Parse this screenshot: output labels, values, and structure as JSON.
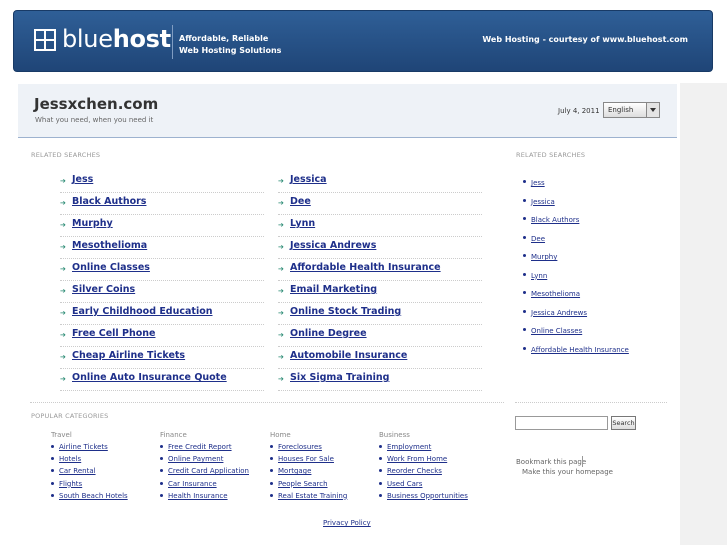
{
  "banner": {
    "logo_light": "blue",
    "logo_bold": "host",
    "tagline_line1": "Affordable, Reliable",
    "tagline_line2": "Web Hosting Solutions",
    "courtesy": "Web Hosting - courtesy of www.bluehost.com"
  },
  "header": {
    "title": "Jessxchen.com",
    "subtitle": "What you need, when you need it",
    "date": "July 4, 2011",
    "language": "English"
  },
  "related": {
    "label": "RELATED SEARCHES",
    "left": [
      "Jess",
      "Black Authors",
      "Murphy",
      "Mesothelioma",
      "Online Classes",
      "Silver Coins",
      "Early Childhood Education",
      "Free Cell Phone",
      "Cheap Airline Tickets",
      "Online Auto Insurance Quote"
    ],
    "right": [
      "Jessica",
      "Dee",
      "Lynn",
      "Jessica Andrews",
      "Affordable Health Insurance",
      "Email Marketing",
      "Online Stock Trading",
      "Online Degree",
      "Automobile Insurance",
      "Six Sigma Training"
    ]
  },
  "sidebar": {
    "label": "RELATED SEARCHES",
    "items": [
      "Jess",
      "Jessica",
      "Black Authors",
      "Dee",
      "Murphy",
      "Lynn",
      "Mesothelioma",
      "Jessica Andrews",
      "Online Classes",
      "Affordable Health Insurance"
    ],
    "search_button": "Search",
    "bookmark": "Bookmark this page",
    "homepage": "Make this your homepage"
  },
  "popular": {
    "label": "POPULAR CATEGORIES",
    "categories": [
      {
        "name": "Travel",
        "items": [
          "Airline Tickets",
          "Hotels",
          "Car Rental",
          "Flights",
          "South Beach Hotels"
        ]
      },
      {
        "name": "Finance",
        "items": [
          "Free Credit Report",
          "Online Payment",
          "Credit Card Application",
          "Car Insurance",
          "Health Insurance"
        ]
      },
      {
        "name": "Home",
        "items": [
          "Foreclosures",
          "Houses For Sale",
          "Mortgage",
          "People Search",
          "Real Estate Training"
        ]
      },
      {
        "name": "Business",
        "items": [
          "Employment",
          "Work From Home",
          "Reorder Checks",
          "Used Cars",
          "Business Opportunities"
        ]
      }
    ]
  },
  "footer": {
    "privacy": "Privacy Policy"
  },
  "colors": {
    "banner": "#1f4577",
    "link": "#1e2f8a",
    "arrow": "#2a8a73"
  }
}
